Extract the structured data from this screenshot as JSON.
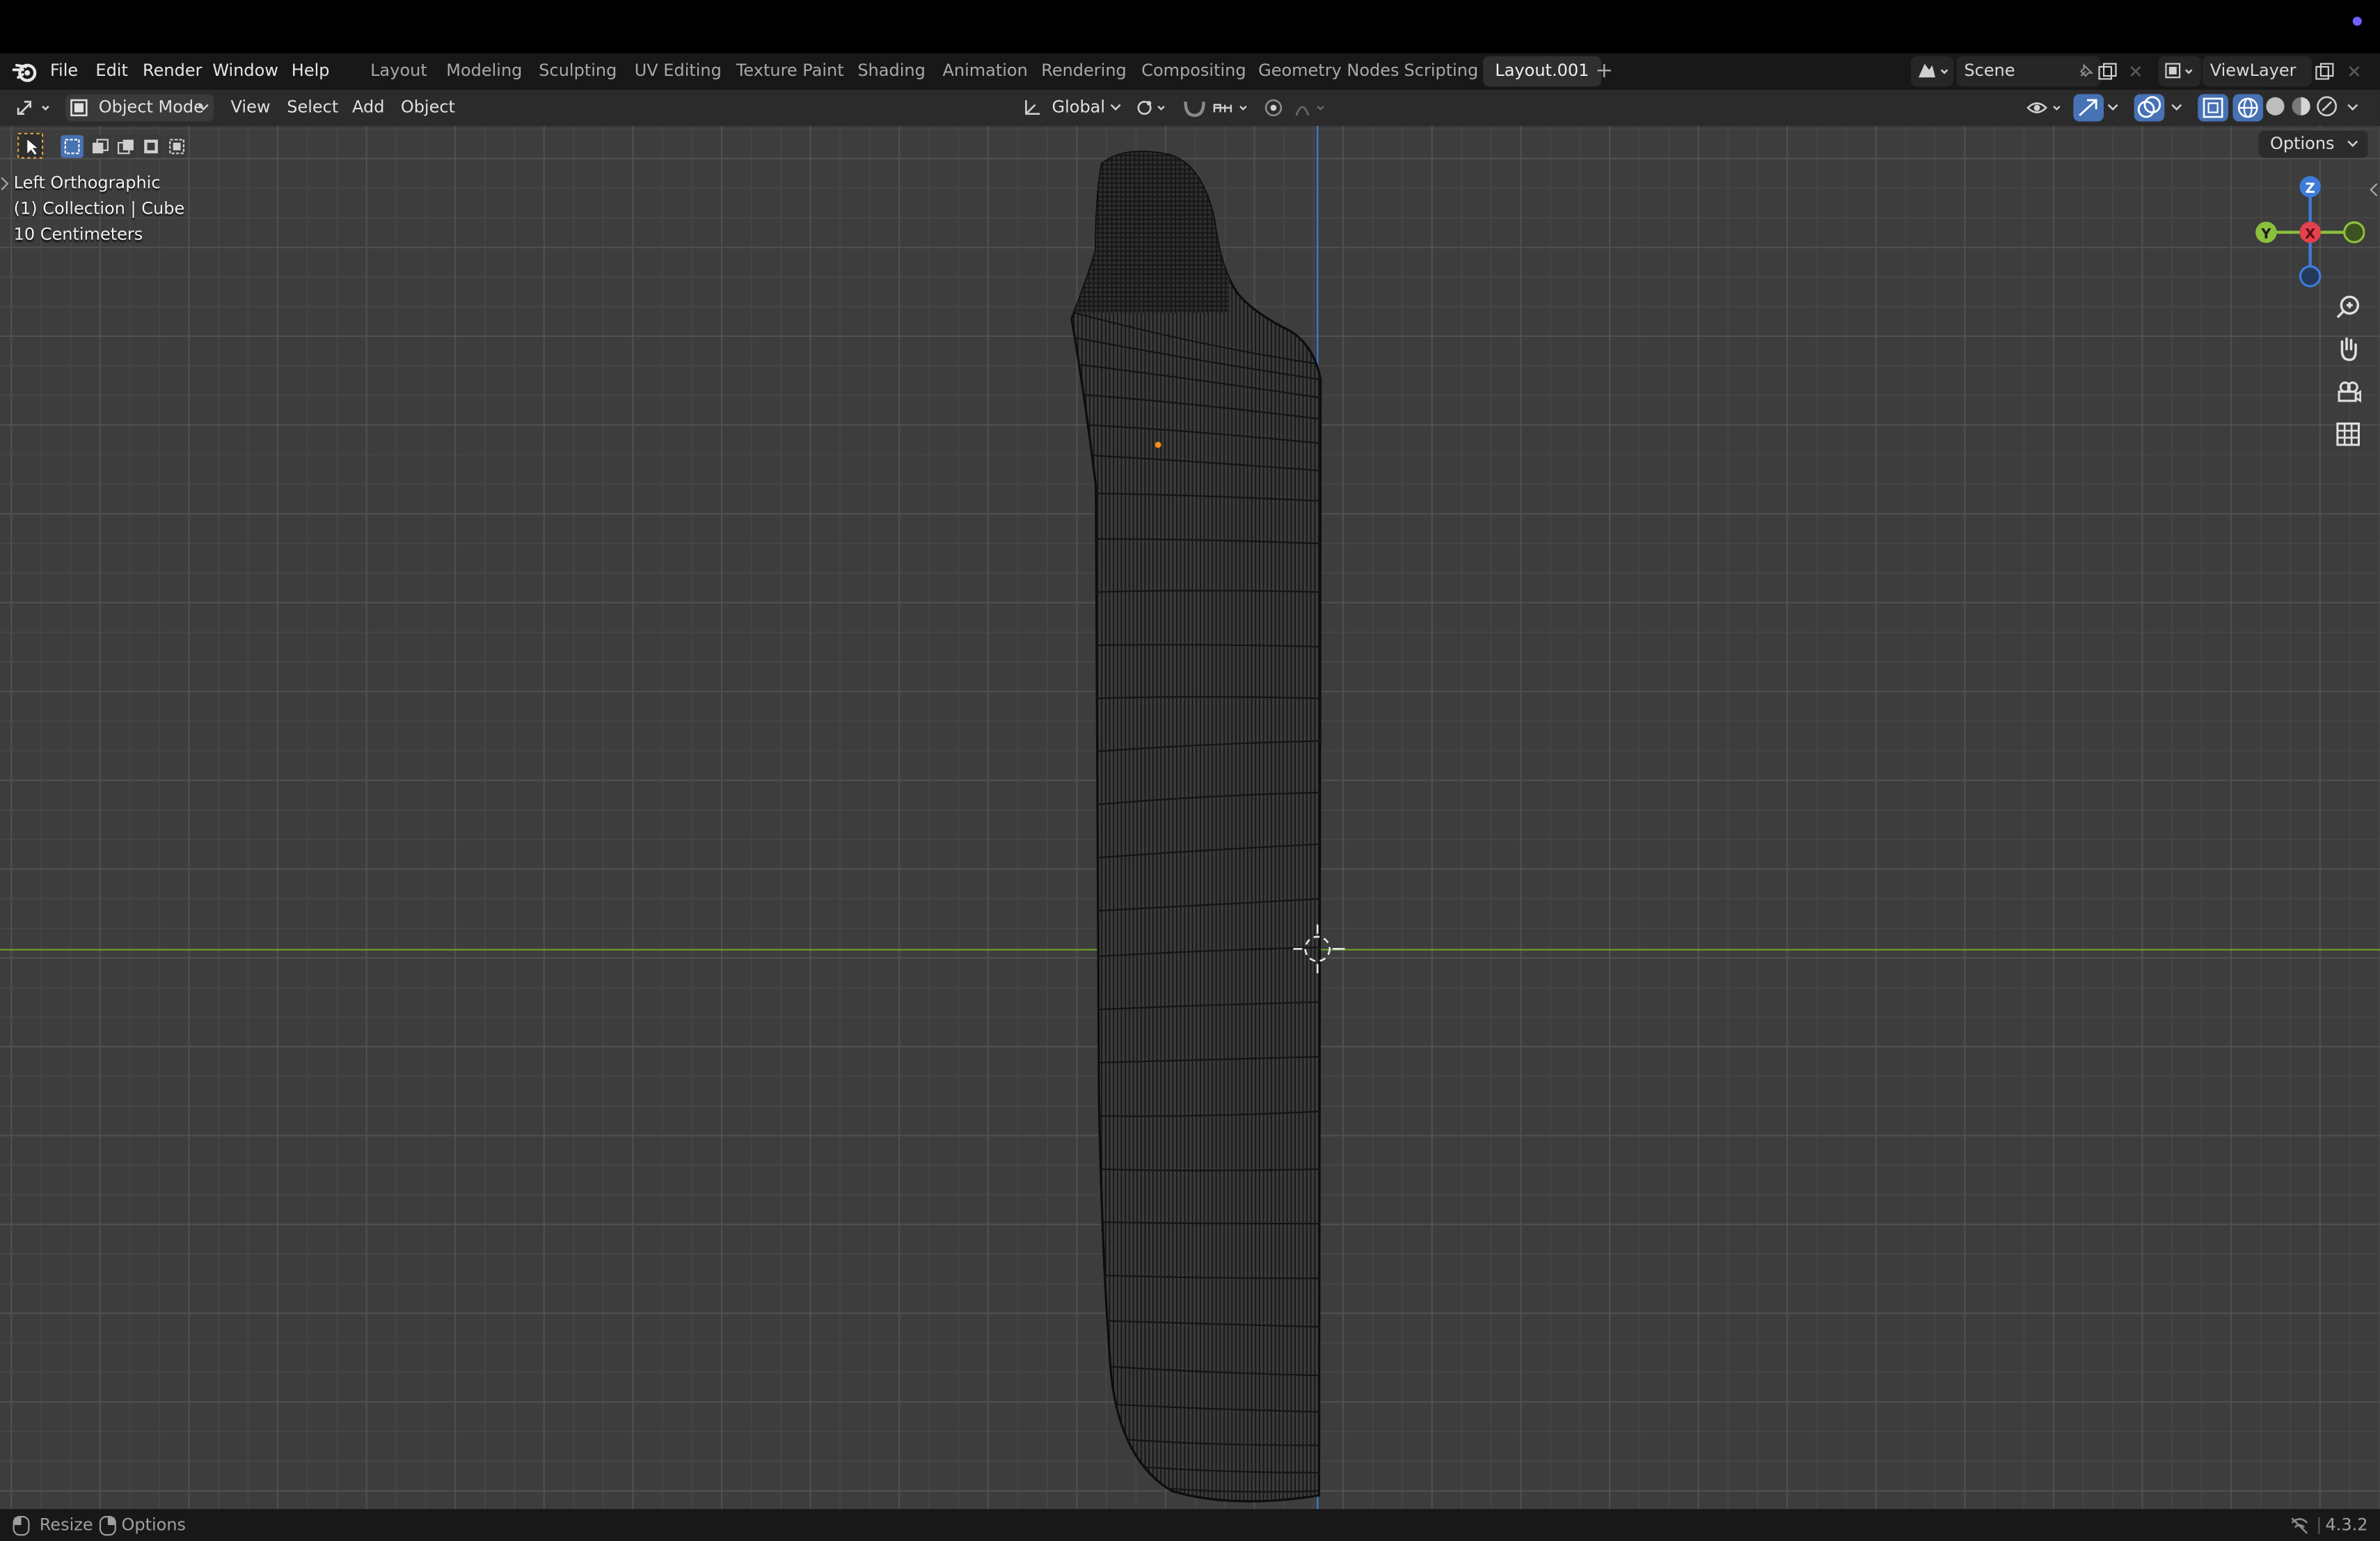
{
  "menu": [
    "File",
    "Edit",
    "Render",
    "Window",
    "Help"
  ],
  "workspaces": [
    "Layout",
    "Modeling",
    "Sculpting",
    "UV Editing",
    "Texture Paint",
    "Shading",
    "Animation",
    "Rendering",
    "Compositing",
    "Geometry Nodes",
    "Scripting",
    "Layout.001"
  ],
  "active_workspace": "Layout.001",
  "add_tab": "+",
  "scene": {
    "name": "Scene",
    "view_layer": "ViewLayer"
  },
  "header": {
    "mode": "Object Mode",
    "view": "View",
    "select": "Select",
    "add": "Add",
    "object": "Object",
    "orientation": "Global"
  },
  "viewport": {
    "view_name": "Left Orthographic",
    "collection_info": "(1) Collection | Cube",
    "scale_info": "10 Centimeters",
    "options": "Options",
    "gizmo": {
      "z": "Z",
      "y": "Y",
      "x": "X"
    }
  },
  "status": {
    "resize": "Resize",
    "options": "Options",
    "version": "4.3.2"
  },
  "colors": {
    "viewport_bg": "#3d3d3d",
    "x_axis": "#e2414d",
    "y_axis": "#8bbf3c",
    "z_axis": "#3f7bd9",
    "horizon_line": "#6a9a2c",
    "vertical_line": "#3d78c4",
    "accent": "#4772b3"
  },
  "icons": [
    "blender-logo-icon",
    "editor-type-icon",
    "object-mode-icon",
    "transform-orientation-icon",
    "pivot-icon",
    "snap-icon",
    "proportional-edit-icon",
    "visibility-icon",
    "gizmo-icon",
    "overlay-icon",
    "xray-icon",
    "wireframe-shading-icon",
    "solid-shading-icon",
    "material-shading-icon",
    "rendered-shading-icon",
    "zoom-icon",
    "pan-hand-icon",
    "camera-icon",
    "grid-icon"
  ]
}
